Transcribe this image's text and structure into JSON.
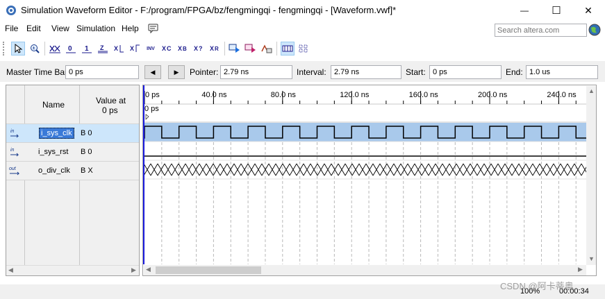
{
  "window": {
    "title": "Simulation Waveform Editor - F:/program/FPGA/bz/fengmingqi - fengmingqi - [Waveform.vwf]*",
    "minimize_glyph": "—",
    "maximize_glyph": "☐",
    "close_glyph": "✕"
  },
  "menu": [
    "File",
    "Edit",
    "View",
    "Simulation",
    "Help"
  ],
  "search": {
    "placeholder": "Search altera.com"
  },
  "toolbar": {
    "icons": [
      "pointer-tool",
      "zoom-tool",
      "count-value",
      "force-low",
      "force-high",
      "force-hi-z",
      "invert",
      "count-binary",
      "clock",
      "inverted-clock",
      "random",
      "overwrite-clock",
      "undefined",
      "weak-high",
      "snap-to-grid",
      "grid",
      "run-functional-sim",
      "run-timing-sim",
      "estimate"
    ],
    "labels": {
      "inv": "INV",
      "x": "X"
    }
  },
  "infobar": {
    "master_label": "Master Time Bar:",
    "master_value": "0 ps",
    "pointer_label": "Pointer:",
    "pointer_value": "2.79 ns",
    "interval_label": "Interval:",
    "interval_value": "2.79 ns",
    "start_label": "Start:",
    "start_value": "0 ps",
    "end_label": "End:",
    "end_value": "1.0 us"
  },
  "names": {
    "header_name": "Name",
    "header_value_line1": "Value at",
    "header_value_line2": "0 ps"
  },
  "signals": [
    {
      "name": "i_sys_clk",
      "value": "B 0",
      "direction": "in",
      "waveform": "clock",
      "selected": true
    },
    {
      "name": "i_sys_rst",
      "value": "B 0",
      "direction": "in",
      "waveform": "low",
      "selected": false
    },
    {
      "name": "o_div_clk",
      "value": "B X",
      "direction": "out",
      "waveform": "unknown",
      "selected": false
    }
  ],
  "timeline": {
    "ticks": [
      "0 ps",
      "40.0 ns",
      "80.0 ns",
      "120.0 ns",
      "160.0 ns",
      "200.0 ns",
      "240.0 ns"
    ],
    "marker_label": "0 ps",
    "clock_period_ns": 20
  },
  "status": {
    "zoom": "100%",
    "time": "00:00:34",
    "watermark": "CSDN @阿卡蒂奥"
  },
  "colors": {
    "selection": "#cde6fb",
    "wave_selected_bg": "#a9c9eb",
    "marker": "#1a1ae0",
    "grid": "#c0c0c0"
  }
}
